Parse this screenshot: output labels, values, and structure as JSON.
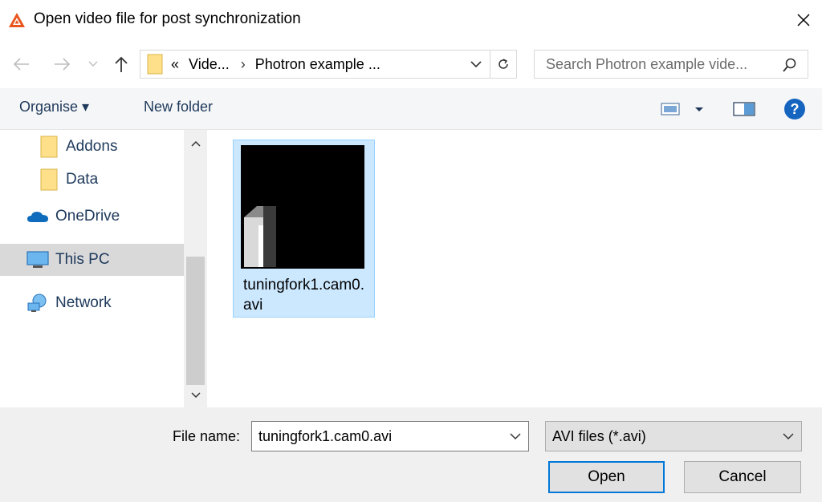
{
  "window": {
    "title": "Open video file for post synchronization",
    "app_icon": "app-logo-icon",
    "close_icon": "close-icon"
  },
  "navigation": {
    "back_icon": "arrow-left-icon",
    "forward_icon": "arrow-right-icon",
    "recent_icon": "chevron-down-icon",
    "up_icon": "arrow-up-icon",
    "address": {
      "overflow": "«",
      "segments": [
        "Vide...",
        "Photron example ..."
      ],
      "separator": "›"
    },
    "refresh_icon": "refresh-icon",
    "search": {
      "placeholder": "Search Photron example vide...",
      "icon": "search-icon"
    }
  },
  "commandbar": {
    "organise_label": "Organise ▾",
    "new_folder_label": "New folder",
    "view_icon": "view-options-icon",
    "preview_icon": "preview-pane-icon",
    "help_icon": "help-icon"
  },
  "sidebar": {
    "items": [
      {
        "label": "Addons",
        "icon": "folder-icon"
      },
      {
        "label": "Data",
        "icon": "folder-icon"
      },
      {
        "label": "OneDrive",
        "icon": "cloud-icon"
      },
      {
        "label": "This PC",
        "icon": "computer-icon",
        "selected": true
      },
      {
        "label": "Network",
        "icon": "network-icon"
      }
    ]
  },
  "files": [
    {
      "name": "tuningfork1.cam0.avi",
      "selected": true
    }
  ],
  "bottom": {
    "file_name_label": "File name:",
    "file_name_value": "tuningfork1.cam0.avi",
    "filter_value": "AVI files (*.avi)",
    "open_label": "Open",
    "cancel_label": "Cancel"
  },
  "colors": {
    "accent": "#0078d7",
    "selection": "#cce8ff",
    "link_text": "#1e395b"
  }
}
